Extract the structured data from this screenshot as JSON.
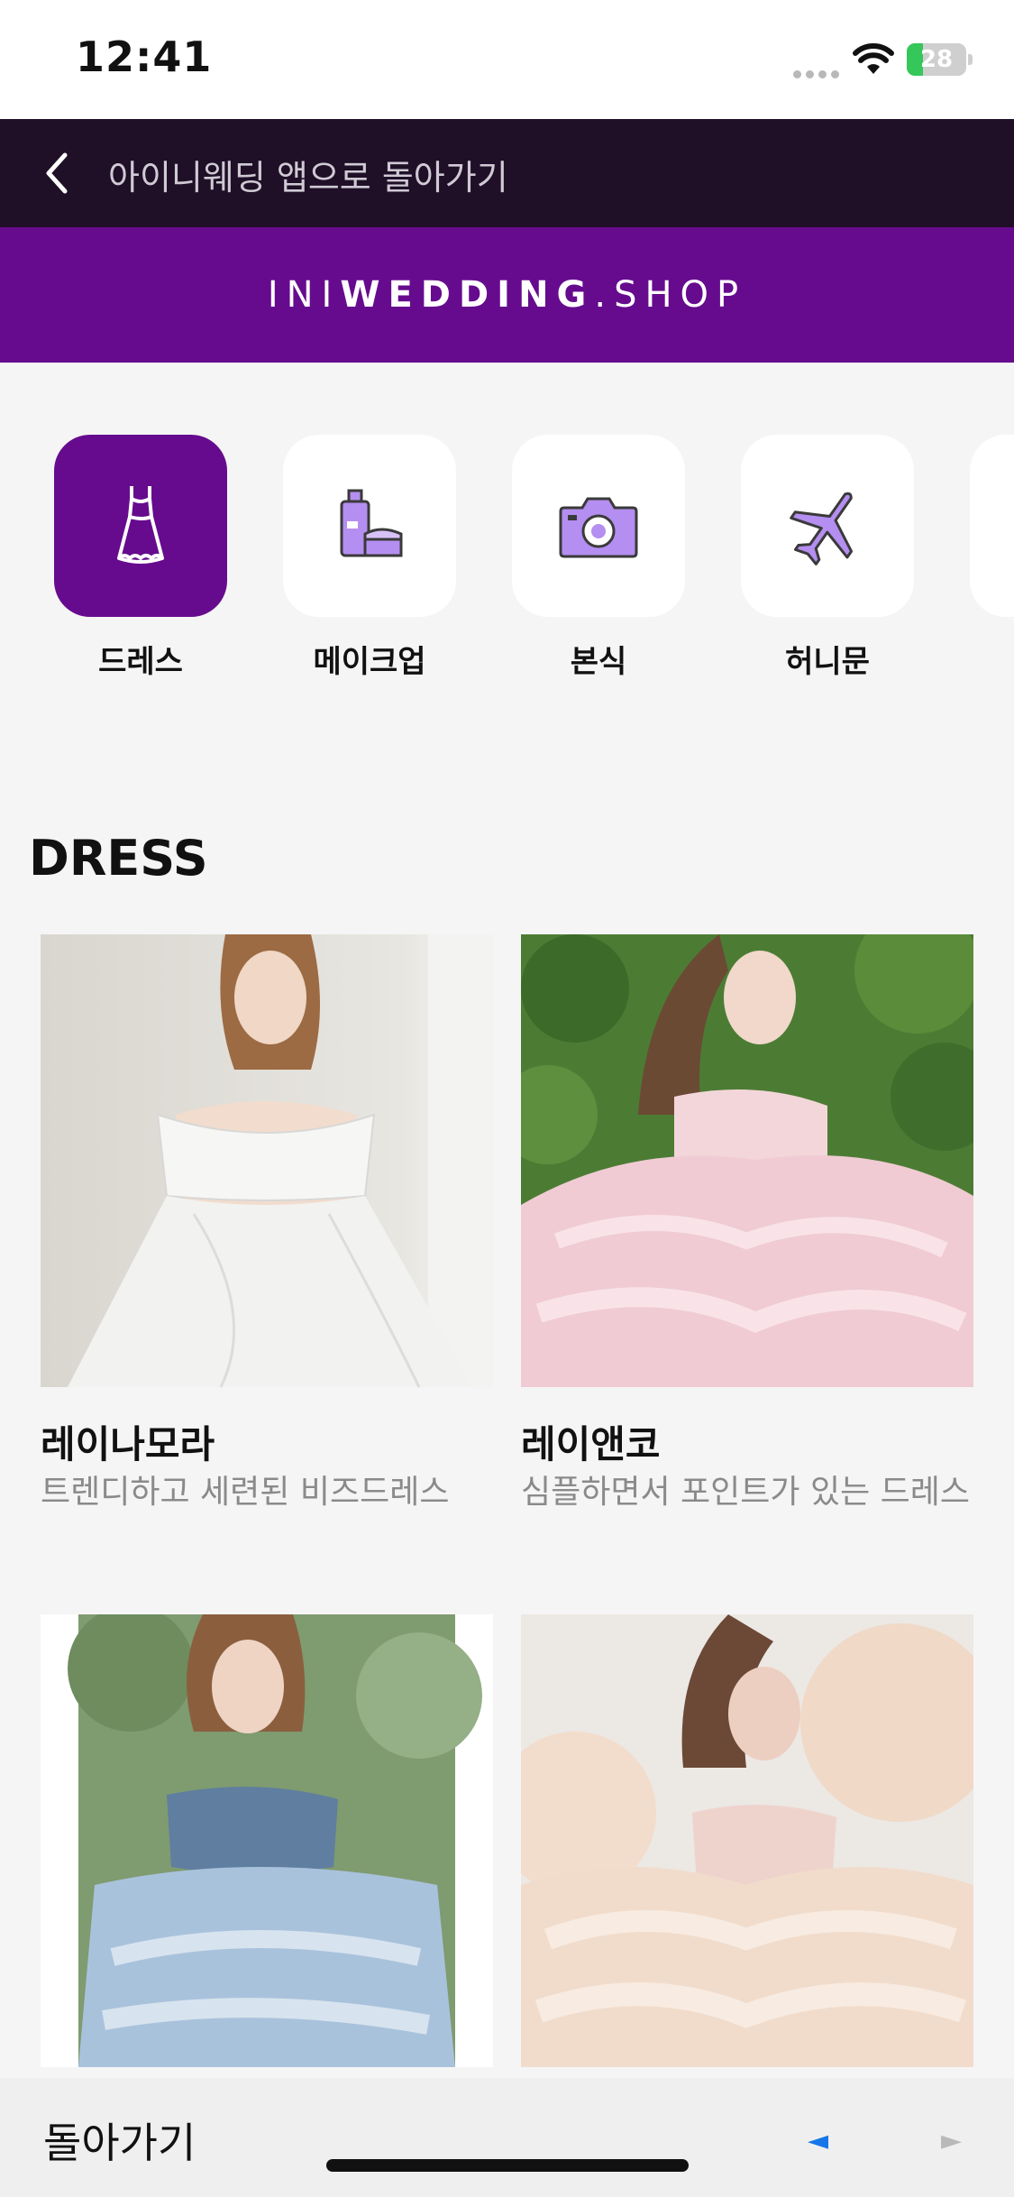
{
  "status": {
    "time": "12:41",
    "battery": "28",
    "battery_level": 0.28
  },
  "nav": {
    "back_label": "아이니웨딩 앱으로 돌아가기"
  },
  "brand": {
    "prefix": "INI",
    "bold": "WEDDING",
    "suffix": ".SHOP"
  },
  "categories": [
    {
      "label": "드레스",
      "icon": "dress-icon",
      "active": true
    },
    {
      "label": "메이크업",
      "icon": "makeup-icon",
      "active": false
    },
    {
      "label": "본식",
      "icon": "camera-icon",
      "active": false
    },
    {
      "label": "허니문",
      "icon": "airplane-icon",
      "active": false
    }
  ],
  "section": {
    "title": "DRESS"
  },
  "products": [
    {
      "name": "레이나모라",
      "desc": "트렌디하고 세련된 비즈드레스"
    },
    {
      "name": "레이앤코",
      "desc": "심플하면서 포인트가 있는 드레스"
    },
    {
      "name": "",
      "desc": ""
    },
    {
      "name": "",
      "desc": ""
    }
  ],
  "toolbar": {
    "back_label": "돌아가기",
    "prev": "◄",
    "next": "►"
  },
  "colors": {
    "brand": "#660b8e",
    "nav": "#1f0f27",
    "icon_purple": "#b48ef0"
  }
}
